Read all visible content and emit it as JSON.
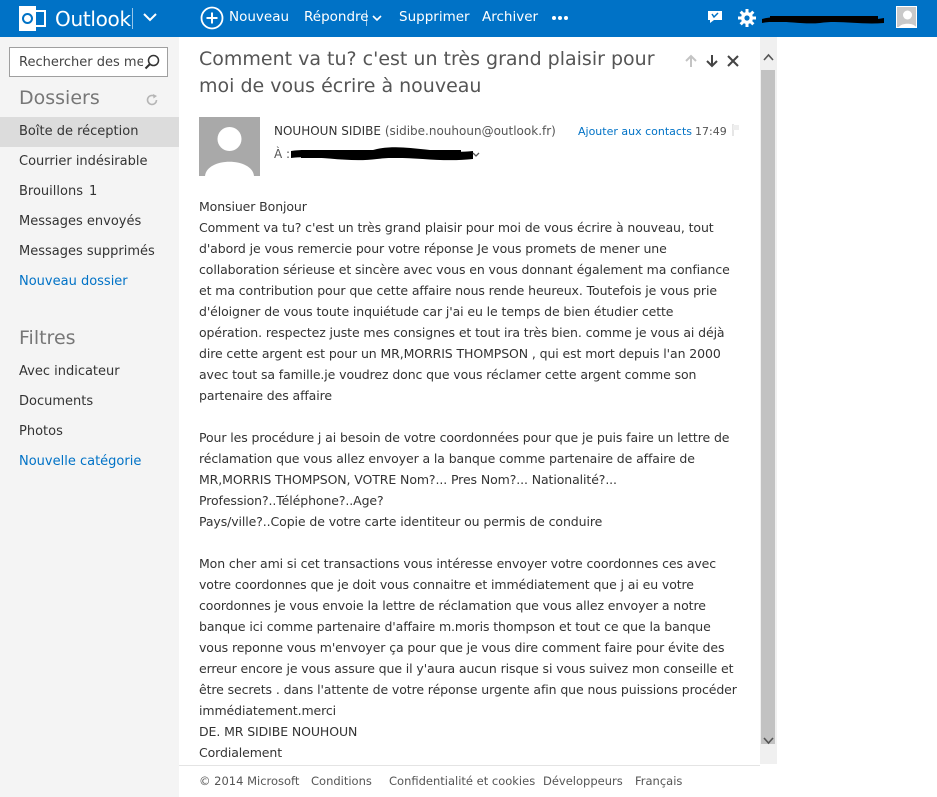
{
  "brand": {
    "name": "Outlook"
  },
  "toolbar": {
    "new_label": "Nouveau",
    "reply_label": "Répondre",
    "delete_label": "Supprimer",
    "archive_label": "Archiver",
    "more_label": "•••"
  },
  "search": {
    "placeholder": "Rechercher des messages"
  },
  "sidebar": {
    "folders_title": "Dossiers",
    "folders": [
      {
        "label": "Boîte de réception",
        "selected": true
      },
      {
        "label": "Courrier indésirable"
      },
      {
        "label": "Brouillons",
        "count": "1"
      },
      {
        "label": "Messages envoyés"
      },
      {
        "label": "Messages supprimés"
      },
      {
        "label": "Nouveau dossier",
        "link": true
      }
    ],
    "filters_title": "Filtres",
    "filters": [
      {
        "label": "Avec indicateur"
      },
      {
        "label": "Documents"
      },
      {
        "label": "Photos"
      },
      {
        "label": "Nouvelle catégorie",
        "link": true
      }
    ]
  },
  "message": {
    "subject": "Comment va tu? c'est un très grand plaisir pour moi de vous écrire à nouveau",
    "sender_name": "NOUHOUN SIDIBE",
    "sender_email": "(sidibe.nouhoun@outlook.fr)",
    "add_contact": "Ajouter aux contacts",
    "time": "17:49",
    "to_label": "À :",
    "body": "Monsiuer Bonjour\nComment va tu? c'est un très grand plaisir pour moi de vous écrire à nouveau, tout\nd'abord je vous remercie pour votre réponse Je vous promets de mener une\ncollaboration sérieuse et sincère avec vous en vous donnant également ma confiance\net ma contribution pour que cette affaire nous rende heureux. Toutefois je vous prie\nd'éloigner de vous toute inquiétude car j'ai eu le temps de bien étudier cette\nopération. respectez juste mes consignes et tout ira très bien. comme je vous ai déjà\ndire cette argent est pour un MR,MORRIS THOMPSON , qui est mort depuis l'an 2000\navec tout sa famille.je voudrez donc que vous réclamer cette argent comme son\npartenaire des affaire\n\nPour les procédure j ai besoin de votre coordonnées pour que je puis faire un lettre de\nréclamation que vous allez envoyer a la banque comme partenaire de affaire de\nMR,MORRIS THOMPSON, VOTRE Nom?... Pres Nom?... Nationalité?...\nProfession?..Téléphone?..Age?\nPays/ville?..Copie de votre carte identiteur ou permis de conduire\n\nMon cher ami si cet transactions vous intéresse envoyer votre coordonnes ces avec\nvotre coordonnes que je doit vous connaitre et immédiatement que j ai eu votre\ncoordonnes je vous envoie la lettre de réclamation que vous allez envoyer a notre\nbanque ici comme partenaire d'affaire m.moris thompson et tout ce que la banque\nvous reponne vous m'envoyer ça pour que je vous dire comment faire pour évite des\nerreur encore je vous assure que il y'aura aucun risque si vous suivez mon conseille et\nêtre secrets . dans l'attente de votre réponse urgente afin que nous puissions procéder\nimmédiatement.merci\nDE. MR SIDIBE NOUHOUN\nCordialement"
  },
  "footer": {
    "copyright": "© 2014 Microsoft",
    "conditions": "Conditions",
    "privacy": "Confidentialité et cookies",
    "developers": "Développeurs",
    "language": "Français"
  },
  "colors": {
    "accent": "#0072c6",
    "sidebar_bg": "#f4f4f4",
    "selected_bg": "#dcdcdc"
  },
  "icons": [
    "outlook-logo-icon",
    "chevron-down-icon",
    "plus-circle-icon",
    "more-icon",
    "chat-icon",
    "gear-icon",
    "search-icon",
    "refresh-icon",
    "up-arrow-icon",
    "down-arrow-icon",
    "close-icon",
    "flag-icon",
    "person-icon"
  ]
}
